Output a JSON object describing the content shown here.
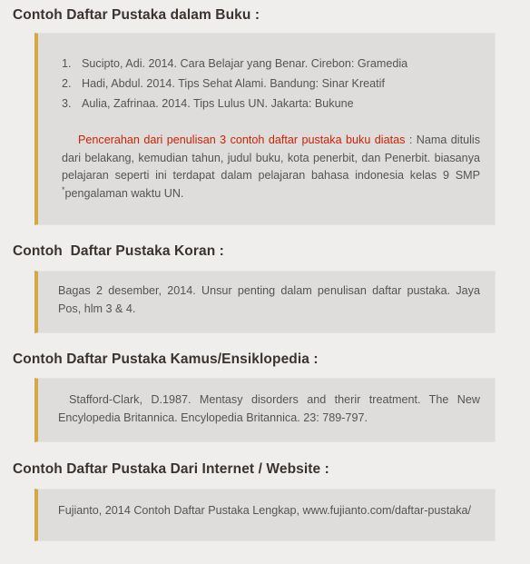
{
  "sections": [
    {
      "heading": "Contoh Daftar Pustaka dalam Buku :",
      "citations": [
        {
          "number": "1.",
          "text": "Sucipto, Adi. 2014. Cara Belajar yang Benar. Cirebon: Gramedia"
        },
        {
          "number": "2.",
          "text": "Hadi, Abdul. 2014. Tips Sehat Alami. Bandung: Sinar Kreatif"
        },
        {
          "number": "3.",
          "text": "Aulia, Zafrinaa. 2014. Tips Lulus UN. Jakarta: Bukune"
        }
      ],
      "note": {
        "highlight": "Pencerahan dari penulisan 3 contoh daftar pustaka buku diatas",
        "rest": " : Nama ditulis dari belakang, kemudian tahun, judul buku, kota penerbit, dan Penerbit. biasanya pelajaran seperti ini terdapat dalam pelajaran bahasa indonesia kelas 9 SMP ",
        "footnote_marker": "*",
        "footnote": "pengalaman waktu UN."
      }
    },
    {
      "heading": "Contoh  Daftar Pustaka Koran :",
      "body": "Bagas 2 desember, 2014. Unsur penting dalam penulisan daftar pustaka. Jaya Pos, hlm 3 & 4."
    },
    {
      "heading": "Contoh Daftar Pustaka Kamus/Ensiklopedia :",
      "body": "Stafford-Clark,  D.1987.  Mentasy  disorders  and  therir  treatment.  The  New Encylopedia Britannica. Encylopedia Britannica. 23: 789-797."
    },
    {
      "heading": "Contoh Daftar Pustaka Dari Internet / Website :",
      "body": "Fujianto, 2014 Contoh Daftar Pustaka Lengkap, www.fujianto.com/daftar-pustaka/"
    }
  ],
  "colors": {
    "page_background": "#efeeec",
    "box_background": "#dedddb",
    "accent_border": "#d4a843",
    "heading_text": "#3a3330",
    "body_text": "#575350",
    "highlight_text": "#cc2200"
  }
}
